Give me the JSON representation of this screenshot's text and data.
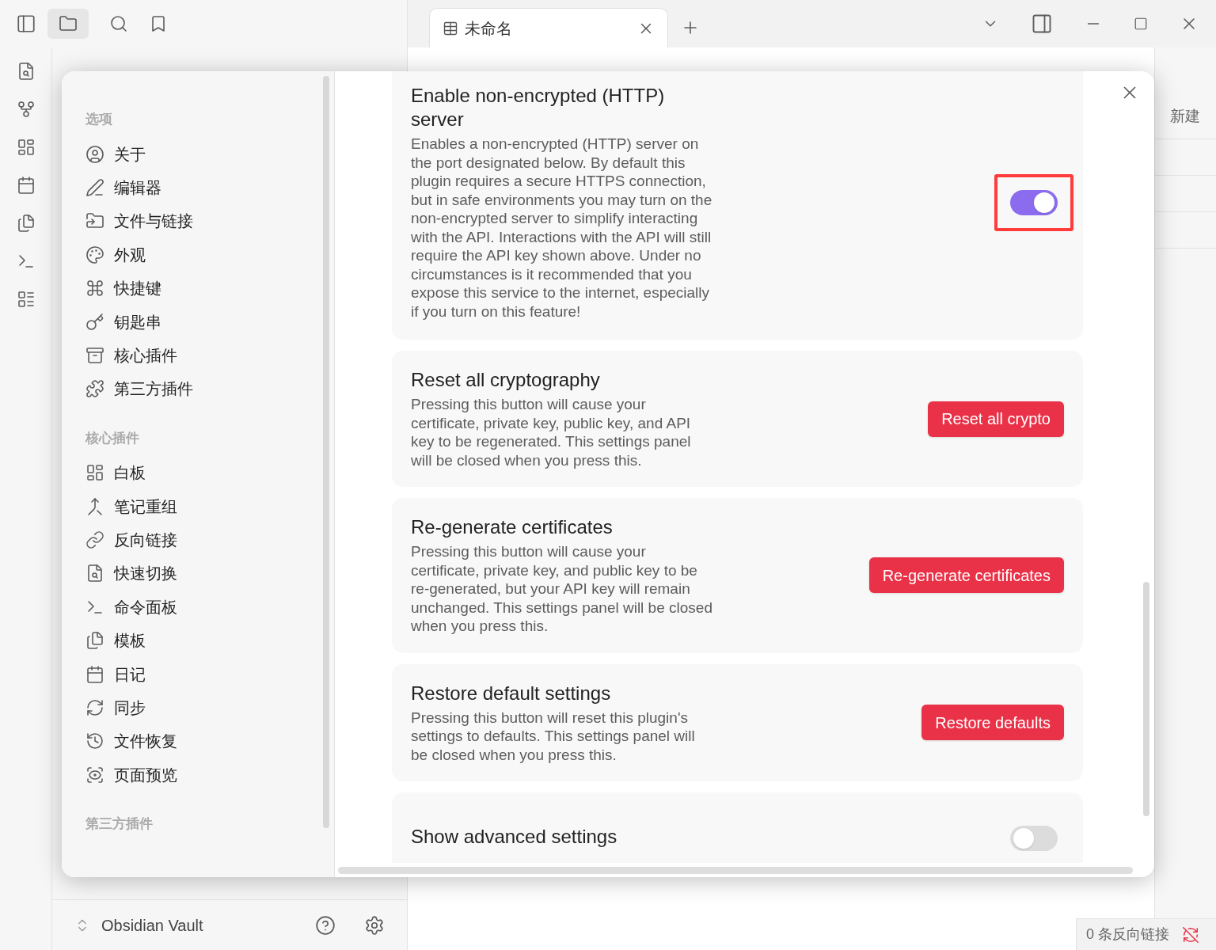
{
  "app": {
    "tab": {
      "title": "未命名",
      "selected": true
    },
    "right_panel": {
      "new_label": "新建"
    },
    "vault": {
      "name": "Obsidian Vault"
    },
    "status_bar": {
      "backlinks": "0 条反向链接"
    }
  },
  "settings": {
    "sidebar": {
      "sections": [
        {
          "title": "选项",
          "items": [
            "关于",
            "编辑器",
            "文件与链接",
            "外观",
            "快捷键",
            "钥匙串",
            "核心插件",
            "第三方插件"
          ]
        },
        {
          "title": "核心插件",
          "items": [
            "白板",
            "笔记重组",
            "反向链接",
            "快速切换",
            "命令面板",
            "模板",
            "日记",
            "同步",
            "文件恢复",
            "页面预览"
          ]
        },
        {
          "title": "第三方插件"
        }
      ]
    },
    "cards": [
      {
        "kind": "toggle",
        "title": "Enable non-encrypted (HTTP) server",
        "description": "Enables a non-encrypted (HTTP) server on the port designated below. By default this plugin requires a secure HTTPS connection, but in safe environments you may turn on the non-encrypted server to simplify interacting with the API. Interactions with the API will still require the API key shown above. Under no circumstances is it recommended that you expose this service to the internet, especially if you turn on this feature!",
        "on": true,
        "highlighted": true
      },
      {
        "kind": "button",
        "title": "Reset all cryptography",
        "description": "Pressing this button will cause your certificate, private key, public key, and API key to be regenerated. This settings panel will be closed when you press this.",
        "button": "Reset all crypto"
      },
      {
        "kind": "button",
        "title": "Re-generate certificates",
        "description": "Pressing this button will cause your certificate, private key, and public key to be re-generated, but your API key will remain unchanged. This settings panel will be closed when you press this.",
        "button": "Re-generate certificates"
      },
      {
        "kind": "button",
        "title": "Restore default settings",
        "description": "Pressing this button will reset this plugin's settings to defaults. This settings panel will be closed when you press this.",
        "button": "Restore defaults"
      },
      {
        "kind": "toggle",
        "title": "Show advanced settings",
        "on": false,
        "highlighted": false
      }
    ]
  }
}
